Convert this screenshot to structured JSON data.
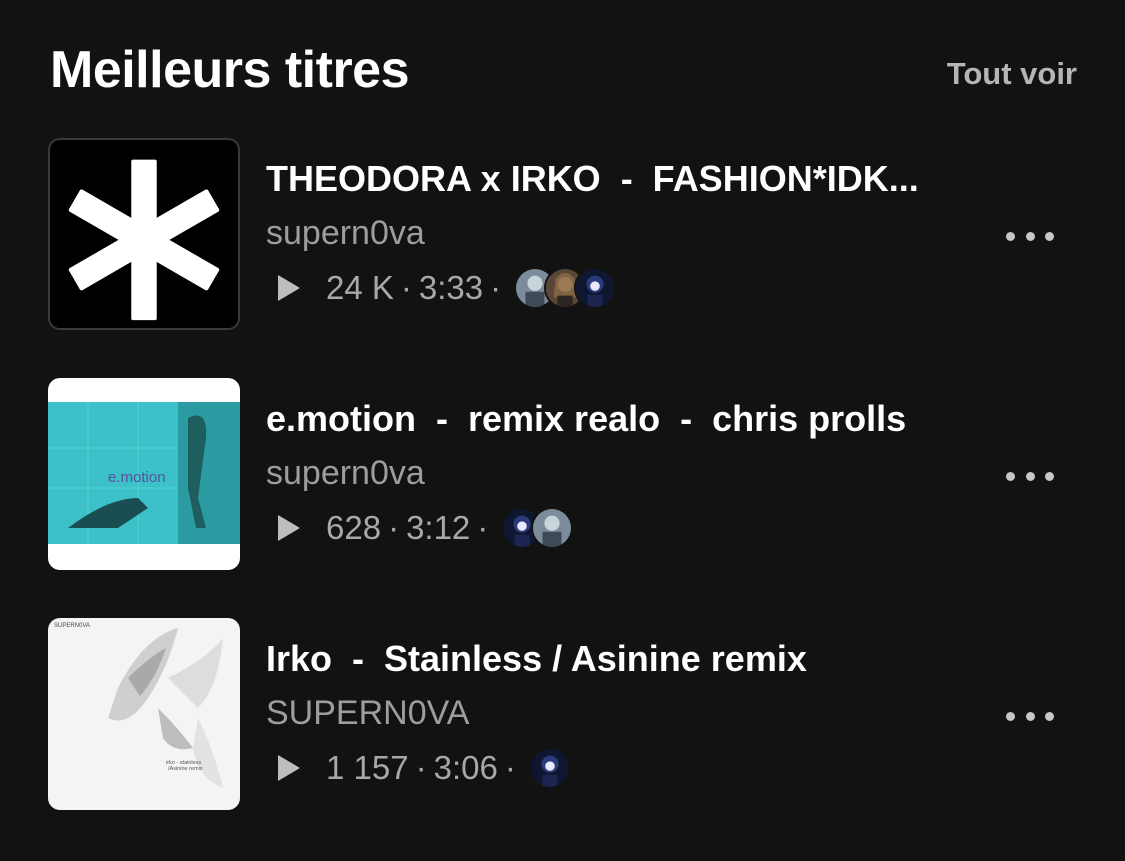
{
  "section": {
    "title": "Meilleurs titres",
    "see_all": "Tout voir"
  },
  "tracks": [
    {
      "title": "THEODORA x IRKO  -  FASHION*IDK...",
      "artist": "supern0va",
      "plays": "24 K",
      "duration": "3:33",
      "avatars": [
        "avatar-grey-figure",
        "avatar-girl",
        "avatar-anime-dark"
      ]
    },
    {
      "title": "e.motion  -  remix realo  -  chris prolls",
      "artist": "supern0va",
      "plays": "628",
      "duration": "3:12",
      "avatars": [
        "avatar-anime-dark",
        "avatar-grey-figure"
      ]
    },
    {
      "title": "Irko  -  Stainless / Asinine remix",
      "artist": "SUPERN0VA",
      "plays": "1 157",
      "duration": "3:06",
      "avatars": [
        "avatar-anime-dark"
      ]
    }
  ],
  "covers": {
    "cover1_text": "",
    "cover2_text": "e.motion",
    "cover3_label": "SUPERN0VA",
    "cover3_caption_1": "irko - stainless",
    "cover3_caption_2": "/Asinine remix"
  },
  "separator": "·",
  "colors": {
    "background": "#121212",
    "secondary_text": "#9d9d9d",
    "accent_teal": "#3cc1c8"
  }
}
